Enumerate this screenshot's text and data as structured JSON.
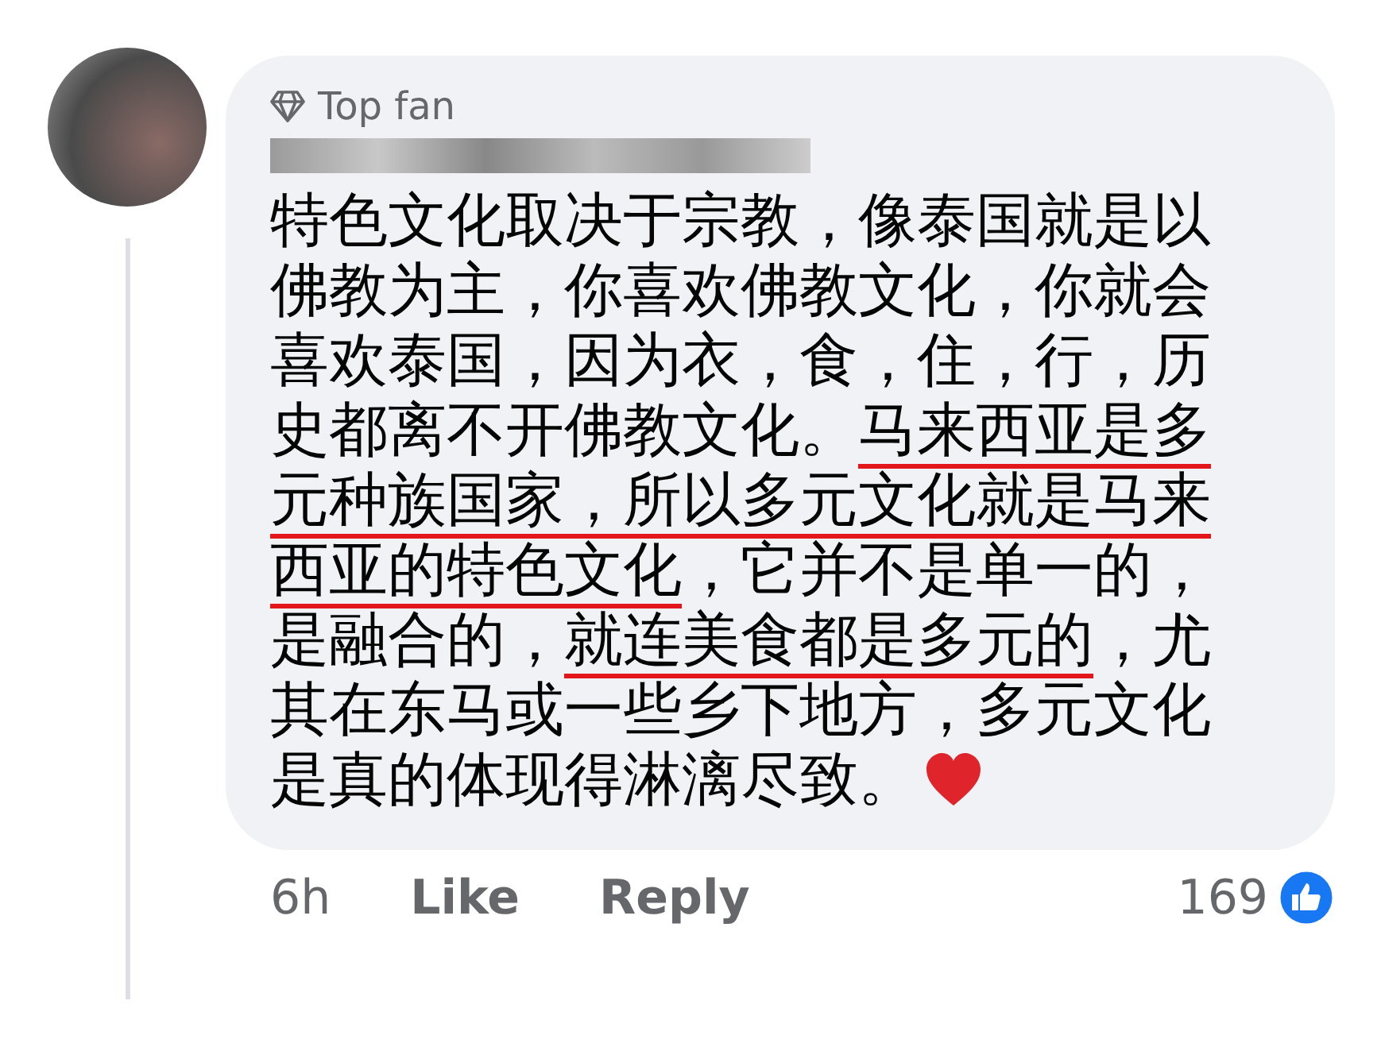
{
  "comment": {
    "badge": "Top fan",
    "segments": [
      {
        "text": "特色文化取决于宗教，像泰国就是以佛教为主，你喜欢佛教文化，你就会喜欢泰国，因为衣，食，住，行，历史都离不开佛教文化。",
        "underlined": false
      },
      {
        "text": "马来西亚是多元种族国家，所以多元文化就是马来西亚的特色文化",
        "underlined": true
      },
      {
        "text": "，它并不是单一的，是融合的，",
        "underlined": false
      },
      {
        "text": "就连美食都是多元的",
        "underlined": true
      },
      {
        "text": "，尤其在东马或一些乡下地方，多元文化是真的体现得淋漓尽致。",
        "underlined": false
      }
    ],
    "time": "6h",
    "actions": [
      "Like",
      "Reply"
    ],
    "reactions": "169"
  }
}
